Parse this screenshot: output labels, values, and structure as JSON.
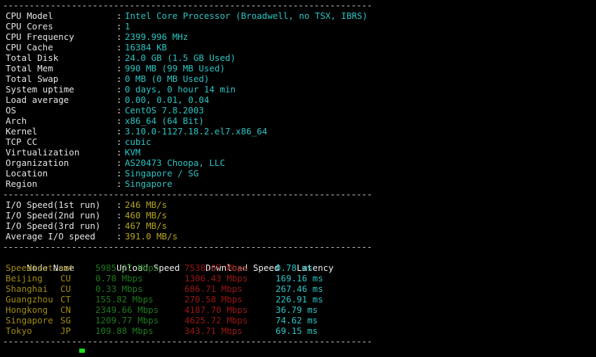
{
  "terminal": {
    "separator": "----------------------------------------------------------------------",
    "cursor": "block-cursor"
  },
  "system_info": {
    "rows": [
      {
        "label": "CPU Model",
        "value": "Intel Core Processor (Broadwell, no TSX, IBRS)"
      },
      {
        "label": "CPU Cores",
        "value": "1"
      },
      {
        "label": "CPU Frequency",
        "value": "2399.996 MHz"
      },
      {
        "label": "CPU Cache",
        "value": "16384 KB"
      },
      {
        "label": "Total Disk",
        "value": "24.0 GB (1.5 GB Used)"
      },
      {
        "label": "Total Mem",
        "value": "990 MB (99 MB Used)"
      },
      {
        "label": "Total Swap",
        "value": "0 MB (0 MB Used)"
      },
      {
        "label": "System uptime",
        "value": "0 days, 0 hour 14 min"
      },
      {
        "label": "Load average",
        "value": "0.00, 0.01, 0.04"
      },
      {
        "label": "OS",
        "value": "CentOS 7.8.2003"
      },
      {
        "label": "Arch",
        "value": "x86_64 (64 Bit)"
      },
      {
        "label": "Kernel",
        "value": "3.10.0-1127.18.2.el7.x86_64"
      },
      {
        "label": "TCP CC",
        "value": "cubic"
      },
      {
        "label": "Virtualization",
        "value": "KVM"
      },
      {
        "label": "Organization",
        "value": "AS20473 Choopa, LLC"
      },
      {
        "label": "Location",
        "value": "Singapore / SG"
      },
      {
        "label": "Region",
        "value": "Singapore"
      }
    ]
  },
  "io_speed": {
    "rows": [
      {
        "label": "I/O Speed(1st run)",
        "value": "246 MB/s"
      },
      {
        "label": "I/O Speed(2nd run)",
        "value": "460 MB/s"
      },
      {
        "label": "I/O Speed(3rd run)",
        "value": "467 MB/s"
      },
      {
        "label": "Average I/O speed",
        "value": "391.0 MB/s"
      }
    ]
  },
  "speedtest": {
    "headers": {
      "node": "Node Name",
      "upload": "Upload Speed",
      "download": "Download Speed",
      "latency": "Latency"
    },
    "rows": [
      {
        "node": "Speedtest.net",
        "isp": "",
        "upload": "5985.27 Mbps",
        "download": "7538.07 Mbps",
        "latency": "0.78 ms"
      },
      {
        "node": "Beijing",
        "isp": "CU",
        "upload": "0.78 Mbps",
        "download": "1306.43 Mbps",
        "latency": "169.16 ms"
      },
      {
        "node": "Shanghai",
        "isp": "CU",
        "upload": "0.33 Mbps",
        "download": "686.71 Mbps",
        "latency": "267.46 ms"
      },
      {
        "node": "Guangzhou",
        "isp": "CT",
        "upload": "155.82 Mbps",
        "download": "270.58 Mbps",
        "latency": "226.91 ms"
      },
      {
        "node": "Hongkong",
        "isp": "CN",
        "upload": "2349.66 Mbps",
        "download": "4187.70 Mbps",
        "latency": "36.79 ms"
      },
      {
        "node": "Singapore",
        "isp": "SG",
        "upload": "1209.77 Mbps",
        "download": "4625.72 Mbps",
        "latency": "74.62 ms"
      },
      {
        "node": "Tokyo",
        "isp": "JP",
        "upload": "109.88 Mbps",
        "download": "343.71 Mbps",
        "latency": "69.15 ms"
      }
    ]
  },
  "colors": {
    "background": "#000000",
    "label": "#e6e6e6",
    "value_teal": "#2bc4c4",
    "value_yellow": "#b5a51e",
    "upload_green": "#1d7a1d",
    "download_red": "#9b1616",
    "node_olive": "#a08c16",
    "cursor_green": "#19e019"
  }
}
